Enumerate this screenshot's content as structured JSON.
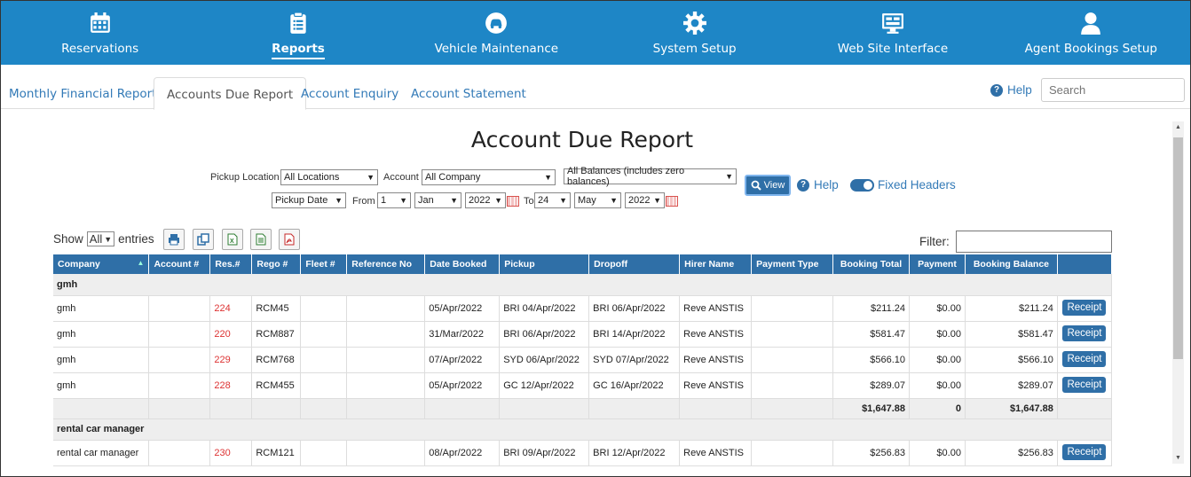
{
  "nav": [
    {
      "label": "Reservations",
      "icon": "calendar-icon",
      "active": false
    },
    {
      "label": "Reports",
      "icon": "clipboard-icon",
      "active": true
    },
    {
      "label": "Vehicle Maintenance",
      "icon": "car-icon",
      "active": false
    },
    {
      "label": "System Setup",
      "icon": "gear-icon",
      "active": false
    },
    {
      "label": "Web Site Interface",
      "icon": "monitor-icon",
      "active": false
    },
    {
      "label": "Agent Bookings Setup",
      "icon": "user-icon",
      "active": false
    }
  ],
  "subtabs": [
    "Monthly Financial Reports",
    "Accounts Due Report",
    "Account Enquiry",
    "Account Statement"
  ],
  "help": "Help",
  "search_placeholder": "Search",
  "title": "Account Due Report",
  "filters": {
    "pickup_location_label": "Pickup Location",
    "pickup_location": "All Locations",
    "account_label": "Account",
    "account": "All Company",
    "balance": "All Balances (includes zero balances)",
    "date_type": "Pickup Date",
    "from_label": "From",
    "from_day": "1",
    "from_month": "Jan",
    "from_year": "2022",
    "to_label": "To",
    "to_day": "24",
    "to_month": "May",
    "to_year": "2022",
    "view_button": "View",
    "help": "Help",
    "fixed_headers": "Fixed Headers"
  },
  "table_toolbar": {
    "show_label": "Show",
    "show_value": "All",
    "entries_label": "entries",
    "filter_label": "Filter:"
  },
  "columns": [
    "Company",
    "Account #",
    "Res.#",
    "Rego #",
    "Fleet #",
    "Reference No",
    "Date Booked",
    "Pickup",
    "Dropoff",
    "Hirer Name",
    "Payment Type",
    "Booking Total",
    "Payment",
    "Booking Balance",
    ""
  ],
  "groups": [
    {
      "name": "gmh",
      "rows": [
        {
          "company": "gmh",
          "account": "",
          "res": "224",
          "rego": "RCM45",
          "fleet": "",
          "ref": "",
          "booked": "05/Apr/2022",
          "pickup": "BRI 04/Apr/2022",
          "dropoff": "BRI 06/Apr/2022",
          "hirer": "Reve ANSTIS",
          "ptype": "",
          "total": "$211.24",
          "payment": "$0.00",
          "balance": "$211.24",
          "action": "Receipt"
        },
        {
          "company": "gmh",
          "account": "",
          "res": "220",
          "rego": "RCM887",
          "fleet": "",
          "ref": "",
          "booked": "31/Mar/2022",
          "pickup": "BRI 06/Apr/2022",
          "dropoff": "BRI 14/Apr/2022",
          "hirer": "Reve ANSTIS",
          "ptype": "",
          "total": "$581.47",
          "payment": "$0.00",
          "balance": "$581.47",
          "action": "Receipt"
        },
        {
          "company": "gmh",
          "account": "",
          "res": "229",
          "rego": "RCM768",
          "fleet": "",
          "ref": "",
          "booked": "07/Apr/2022",
          "pickup": "SYD 06/Apr/2022",
          "dropoff": "SYD 07/Apr/2022",
          "hirer": "Reve ANSTIS",
          "ptype": "",
          "total": "$566.10",
          "payment": "$0.00",
          "balance": "$566.10",
          "action": "Receipt"
        },
        {
          "company": "gmh",
          "account": "",
          "res": "228",
          "rego": "RCM455",
          "fleet": "",
          "ref": "",
          "booked": "05/Apr/2022",
          "pickup": "GC 12/Apr/2022",
          "dropoff": "GC 16/Apr/2022",
          "hirer": "Reve ANSTIS",
          "ptype": "",
          "total": "$289.07",
          "payment": "$0.00",
          "balance": "$289.07",
          "action": "Receipt"
        }
      ],
      "totals": {
        "total": "$1,647.88",
        "payment": "0",
        "balance": "$1,647.88"
      }
    },
    {
      "name": "rental car manager",
      "rows": [
        {
          "company": "rental car manager",
          "account": "",
          "res": "230",
          "rego": "RCM121",
          "fleet": "",
          "ref": "",
          "booked": "08/Apr/2022",
          "pickup": "BRI 09/Apr/2022",
          "dropoff": "BRI 12/Apr/2022",
          "hirer": "Reve ANSTIS",
          "ptype": "",
          "total": "$256.83",
          "payment": "$0.00",
          "balance": "$256.83",
          "action": "Receipt"
        }
      ]
    }
  ]
}
